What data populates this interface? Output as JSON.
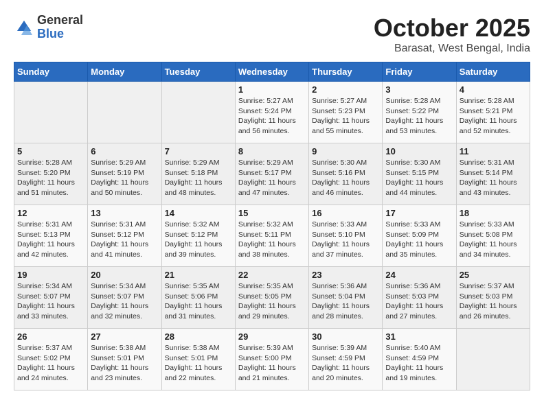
{
  "logo": {
    "general": "General",
    "blue": "Blue"
  },
  "header": {
    "month": "October 2025",
    "subtitle": "Barasat, West Bengal, India"
  },
  "weekdays": [
    "Sunday",
    "Monday",
    "Tuesday",
    "Wednesday",
    "Thursday",
    "Friday",
    "Saturday"
  ],
  "weeks": [
    [
      {
        "day": "",
        "info": ""
      },
      {
        "day": "",
        "info": ""
      },
      {
        "day": "",
        "info": ""
      },
      {
        "day": "1",
        "info": "Sunrise: 5:27 AM\nSunset: 5:24 PM\nDaylight: 11 hours\nand 56 minutes."
      },
      {
        "day": "2",
        "info": "Sunrise: 5:27 AM\nSunset: 5:23 PM\nDaylight: 11 hours\nand 55 minutes."
      },
      {
        "day": "3",
        "info": "Sunrise: 5:28 AM\nSunset: 5:22 PM\nDaylight: 11 hours\nand 53 minutes."
      },
      {
        "day": "4",
        "info": "Sunrise: 5:28 AM\nSunset: 5:21 PM\nDaylight: 11 hours\nand 52 minutes."
      }
    ],
    [
      {
        "day": "5",
        "info": "Sunrise: 5:28 AM\nSunset: 5:20 PM\nDaylight: 11 hours\nand 51 minutes."
      },
      {
        "day": "6",
        "info": "Sunrise: 5:29 AM\nSunset: 5:19 PM\nDaylight: 11 hours\nand 50 minutes."
      },
      {
        "day": "7",
        "info": "Sunrise: 5:29 AM\nSunset: 5:18 PM\nDaylight: 11 hours\nand 48 minutes."
      },
      {
        "day": "8",
        "info": "Sunrise: 5:29 AM\nSunset: 5:17 PM\nDaylight: 11 hours\nand 47 minutes."
      },
      {
        "day": "9",
        "info": "Sunrise: 5:30 AM\nSunset: 5:16 PM\nDaylight: 11 hours\nand 46 minutes."
      },
      {
        "day": "10",
        "info": "Sunrise: 5:30 AM\nSunset: 5:15 PM\nDaylight: 11 hours\nand 44 minutes."
      },
      {
        "day": "11",
        "info": "Sunrise: 5:31 AM\nSunset: 5:14 PM\nDaylight: 11 hours\nand 43 minutes."
      }
    ],
    [
      {
        "day": "12",
        "info": "Sunrise: 5:31 AM\nSunset: 5:13 PM\nDaylight: 11 hours\nand 42 minutes."
      },
      {
        "day": "13",
        "info": "Sunrise: 5:31 AM\nSunset: 5:12 PM\nDaylight: 11 hours\nand 41 minutes."
      },
      {
        "day": "14",
        "info": "Sunrise: 5:32 AM\nSunset: 5:12 PM\nDaylight: 11 hours\nand 39 minutes."
      },
      {
        "day": "15",
        "info": "Sunrise: 5:32 AM\nSunset: 5:11 PM\nDaylight: 11 hours\nand 38 minutes."
      },
      {
        "day": "16",
        "info": "Sunrise: 5:33 AM\nSunset: 5:10 PM\nDaylight: 11 hours\nand 37 minutes."
      },
      {
        "day": "17",
        "info": "Sunrise: 5:33 AM\nSunset: 5:09 PM\nDaylight: 11 hours\nand 35 minutes."
      },
      {
        "day": "18",
        "info": "Sunrise: 5:33 AM\nSunset: 5:08 PM\nDaylight: 11 hours\nand 34 minutes."
      }
    ],
    [
      {
        "day": "19",
        "info": "Sunrise: 5:34 AM\nSunset: 5:07 PM\nDaylight: 11 hours\nand 33 minutes."
      },
      {
        "day": "20",
        "info": "Sunrise: 5:34 AM\nSunset: 5:07 PM\nDaylight: 11 hours\nand 32 minutes."
      },
      {
        "day": "21",
        "info": "Sunrise: 5:35 AM\nSunset: 5:06 PM\nDaylight: 11 hours\nand 31 minutes."
      },
      {
        "day": "22",
        "info": "Sunrise: 5:35 AM\nSunset: 5:05 PM\nDaylight: 11 hours\nand 29 minutes."
      },
      {
        "day": "23",
        "info": "Sunrise: 5:36 AM\nSunset: 5:04 PM\nDaylight: 11 hours\nand 28 minutes."
      },
      {
        "day": "24",
        "info": "Sunrise: 5:36 AM\nSunset: 5:03 PM\nDaylight: 11 hours\nand 27 minutes."
      },
      {
        "day": "25",
        "info": "Sunrise: 5:37 AM\nSunset: 5:03 PM\nDaylight: 11 hours\nand 26 minutes."
      }
    ],
    [
      {
        "day": "26",
        "info": "Sunrise: 5:37 AM\nSunset: 5:02 PM\nDaylight: 11 hours\nand 24 minutes."
      },
      {
        "day": "27",
        "info": "Sunrise: 5:38 AM\nSunset: 5:01 PM\nDaylight: 11 hours\nand 23 minutes."
      },
      {
        "day": "28",
        "info": "Sunrise: 5:38 AM\nSunset: 5:01 PM\nDaylight: 11 hours\nand 22 minutes."
      },
      {
        "day": "29",
        "info": "Sunrise: 5:39 AM\nSunset: 5:00 PM\nDaylight: 11 hours\nand 21 minutes."
      },
      {
        "day": "30",
        "info": "Sunrise: 5:39 AM\nSunset: 4:59 PM\nDaylight: 11 hours\nand 20 minutes."
      },
      {
        "day": "31",
        "info": "Sunrise: 5:40 AM\nSunset: 4:59 PM\nDaylight: 11 hours\nand 19 minutes."
      },
      {
        "day": "",
        "info": ""
      }
    ]
  ]
}
